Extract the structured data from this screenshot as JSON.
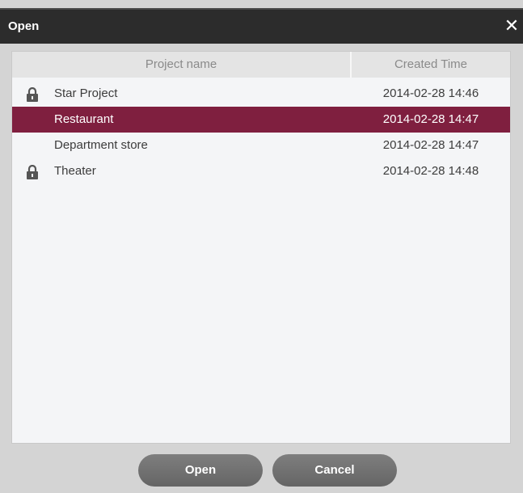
{
  "window": {
    "title": "Open",
    "close_glyph": "✕"
  },
  "table": {
    "headers": {
      "name": "Project name",
      "time": "Created Time"
    },
    "rows": [
      {
        "name": "Star Project",
        "time": "2014-02-28 14:46",
        "locked": true,
        "selected": false
      },
      {
        "name": "Restaurant",
        "time": "2014-02-28 14:47",
        "locked": false,
        "selected": true
      },
      {
        "name": "Department store",
        "time": "2014-02-28 14:47",
        "locked": false,
        "selected": false
      },
      {
        "name": "Theater",
        "time": "2014-02-28 14:48",
        "locked": true,
        "selected": false
      }
    ]
  },
  "buttons": {
    "open_label": "Open",
    "cancel_label": "Cancel"
  },
  "colors": {
    "title_bar": "#2c2c2c",
    "selection": "#7f1f3f",
    "dialog_background": "#d4d4d4",
    "list_background": "#f4f5f7",
    "button": "#717171"
  },
  "icons": {
    "lock": "lock-icon",
    "close": "close-icon"
  }
}
